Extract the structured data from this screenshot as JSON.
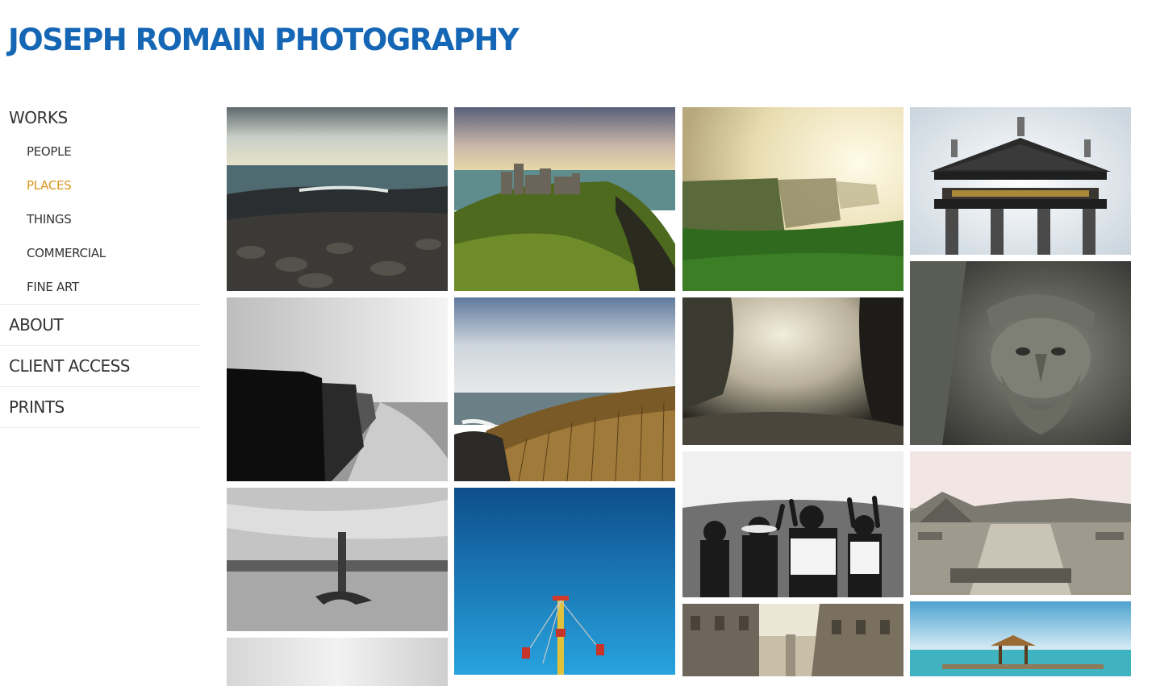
{
  "site": {
    "title": "Joseph Romain Photography"
  },
  "nav": {
    "works": "WORKS",
    "sub_items": [
      "PEOPLE",
      "PLACES",
      "THINGS",
      "COMMERCIAL",
      "FINE ART"
    ],
    "active_sub": "PLACES",
    "about": "ABOUT",
    "client_access": "CLIENT ACCESS",
    "prints": "PRINTS"
  },
  "colors": {
    "brand_blue": "#1566b5",
    "active_nav": "#d9971f",
    "nav_text": "#333333"
  },
  "gallery": {
    "photos": [
      "giants-causeway-sea",
      "dunluce-castle",
      "cliffs-of-moher-sunlit",
      "church-portico-statues",
      "cliffs-black-and-white",
      "causeway-basalt-columns",
      "misty-waterfall",
      "carved-stone-head",
      "pier-post-black-and-white",
      "voladores-pole-blue-sky",
      "crowd-raised-hands",
      "teotihuacan-pyramids",
      "misty-landscape",
      "old-town-street",
      "thatched-pier-hut"
    ]
  }
}
